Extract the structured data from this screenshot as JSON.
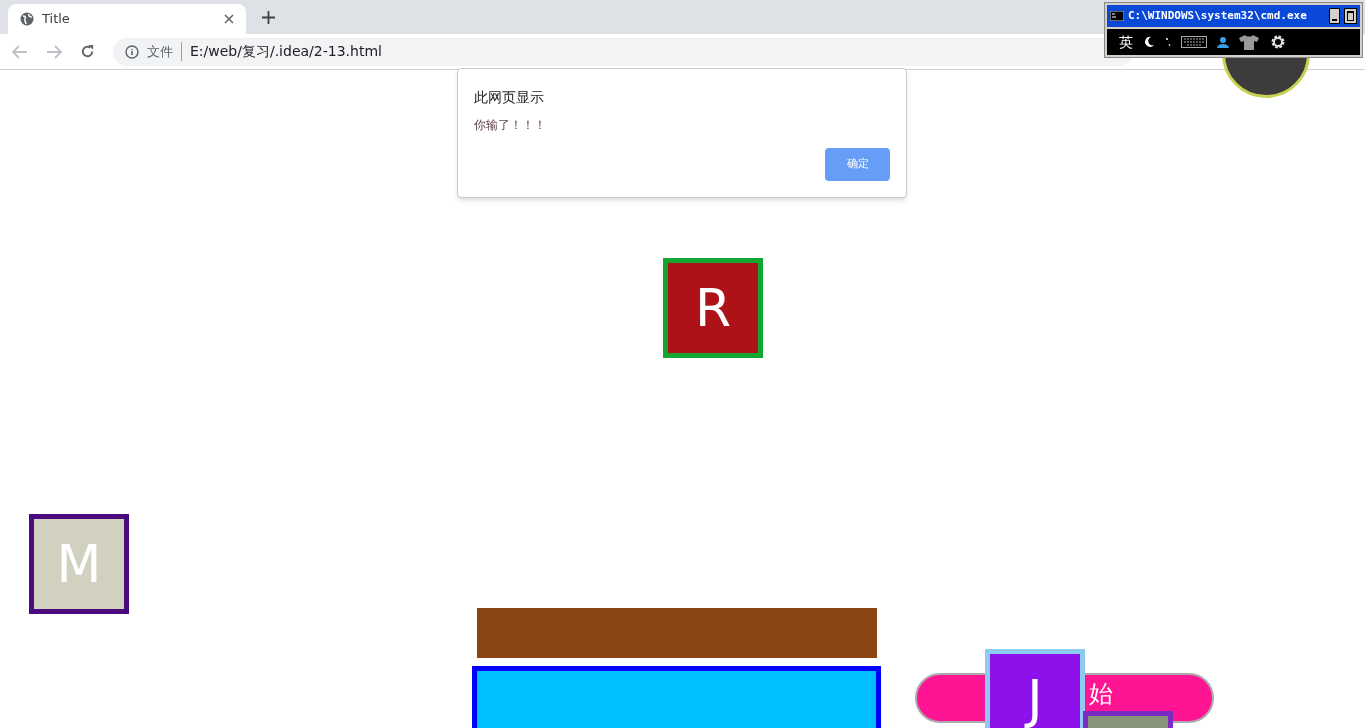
{
  "tab": {
    "title": "Title",
    "selected": true
  },
  "address_bar": {
    "security_label": "文件",
    "url": "E:/web/复习/.idea/2-13.html"
  },
  "dialog": {
    "title": "此网页显示",
    "message": "你输了！！！",
    "ok_button": "确定"
  },
  "cmd_window": {
    "title": "C:\\WINDOWS\\system32\\cmd.exe",
    "ime_mode": "英"
  },
  "game": {
    "blocks": [
      {
        "letter": "R",
        "color": "#ad1218"
      },
      {
        "letter": "M",
        "color": "#d2d1c0"
      },
      {
        "letter": "J",
        "color": "#8e11ec"
      },
      {
        "color": "#88957a"
      }
    ],
    "start_button": "始"
  }
}
